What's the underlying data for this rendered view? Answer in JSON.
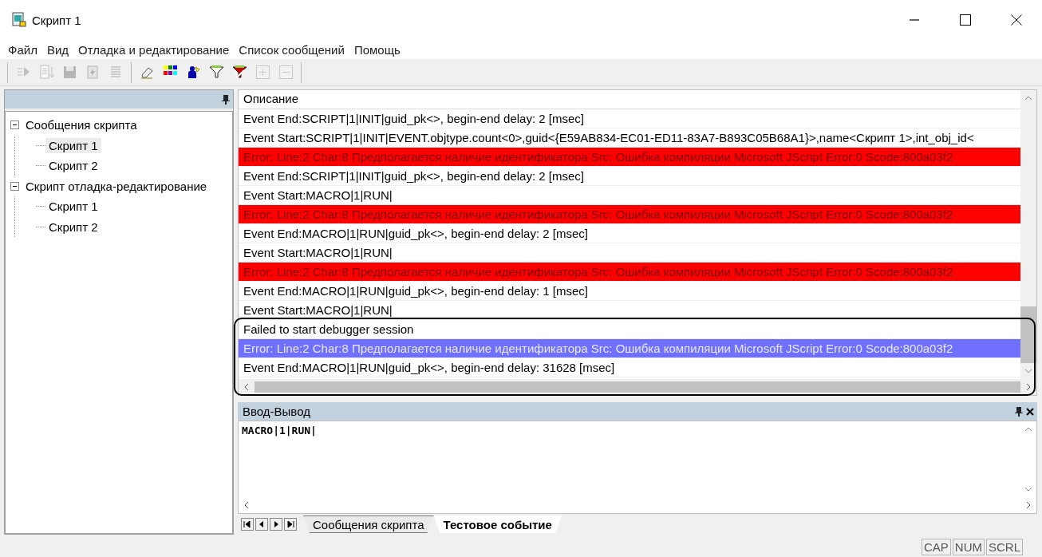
{
  "window": {
    "title": "Скрипт 1"
  },
  "menu": [
    "Файл",
    "Вид",
    "Отладка и редактирование",
    "Список сообщений",
    "Помощь"
  ],
  "toolbar": [
    {
      "kind": "step",
      "disabled": true
    },
    {
      "kind": "list-down",
      "disabled": true
    },
    {
      "kind": "save",
      "disabled": true
    },
    {
      "kind": "page",
      "disabled": true
    },
    {
      "kind": "lines",
      "disabled": true
    },
    {
      "kind": "sep"
    },
    {
      "kind": "eraser",
      "disabled": false
    },
    {
      "kind": "palette",
      "disabled": false
    },
    {
      "kind": "person",
      "disabled": false
    },
    {
      "kind": "filter",
      "disabled": false
    },
    {
      "kind": "filter-check",
      "disabled": false
    },
    {
      "kind": "plus",
      "disabled": true
    },
    {
      "kind": "minus",
      "disabled": true
    }
  ],
  "tree": [
    {
      "label": "Сообщения скрипта",
      "expanded": true,
      "selected": false,
      "children": [
        {
          "label": "Скрипт 1",
          "selected": true
        },
        {
          "label": "Скрипт 2",
          "selected": false
        }
      ]
    },
    {
      "label": "Скрипт отладка-редактирование",
      "expanded": true,
      "selected": false,
      "children": [
        {
          "label": "Скрипт 1",
          "selected": false
        },
        {
          "label": "Скрипт 2",
          "selected": false
        }
      ]
    }
  ],
  "messages": {
    "column": "Описание",
    "rows": [
      {
        "kind": "event",
        "selected": false,
        "text": "Event End:SCRIPT|1|INIT|guid_pk<>, begin-end delay: 2 [msec]"
      },
      {
        "kind": "event",
        "selected": false,
        "text": "Event Start:SCRIPT|1|INIT|EVENT.objtype.count<0>,guid<{E59AB834-EC01-ED11-83A7-B893C05B68A1}>,name<Скрипт 1>,int_obj_id<"
      },
      {
        "kind": "error",
        "selected": false,
        "text": "Error: Line:2 Char:8 Предполагается наличие идентификатора Src: Ошибка компиляции Microsoft JScript Error:0 Scode:800a03f2"
      },
      {
        "kind": "event",
        "selected": false,
        "text": "Event End:SCRIPT|1|INIT|guid_pk<>, begin-end delay: 2 [msec]"
      },
      {
        "kind": "event",
        "selected": false,
        "text": "Event Start:MACRO|1|RUN|"
      },
      {
        "kind": "error",
        "selected": false,
        "text": "Error: Line:2 Char:8 Предполагается наличие идентификатора Src: Ошибка компиляции Microsoft JScript Error:0 Scode:800a03f2"
      },
      {
        "kind": "event",
        "selected": false,
        "text": "Event End:MACRO|1|RUN|guid_pk<>, begin-end delay: 2 [msec]"
      },
      {
        "kind": "event",
        "selected": false,
        "text": "Event Start:MACRO|1|RUN|"
      },
      {
        "kind": "error",
        "selected": false,
        "text": "Error: Line:2 Char:8 Предполагается наличие идентификатора Src: Ошибка компиляции Microsoft JScript Error:0 Scode:800a03f2"
      },
      {
        "kind": "event",
        "selected": false,
        "text": "Event End:MACRO|1|RUN|guid_pk<>, begin-end delay: 1 [msec]"
      },
      {
        "kind": "event",
        "selected": false,
        "text": "Event Start:MACRO|1|RUN|"
      },
      {
        "kind": "event",
        "selected": false,
        "text": "Failed to start debugger session"
      },
      {
        "kind": "error",
        "selected": true,
        "text": "Error: Line:2 Char:8 Предполагается наличие идентификатора Src: Ошибка компиляции Microsoft JScript Error:0 Scode:800a03f2"
      },
      {
        "kind": "event",
        "selected": false,
        "text": "Event End:MACRO|1|RUN|guid_pk<>, begin-end delay: 31628 [msec]"
      }
    ]
  },
  "io": {
    "title": "Ввод-Вывод",
    "value": "MACRO|1|RUN|"
  },
  "tabs": [
    {
      "label": "Сообщения скрипта",
      "selected": false
    },
    {
      "label": "Тестовое событие",
      "selected": true
    }
  ],
  "status": [
    "CAP",
    "NUM",
    "SCRL"
  ]
}
